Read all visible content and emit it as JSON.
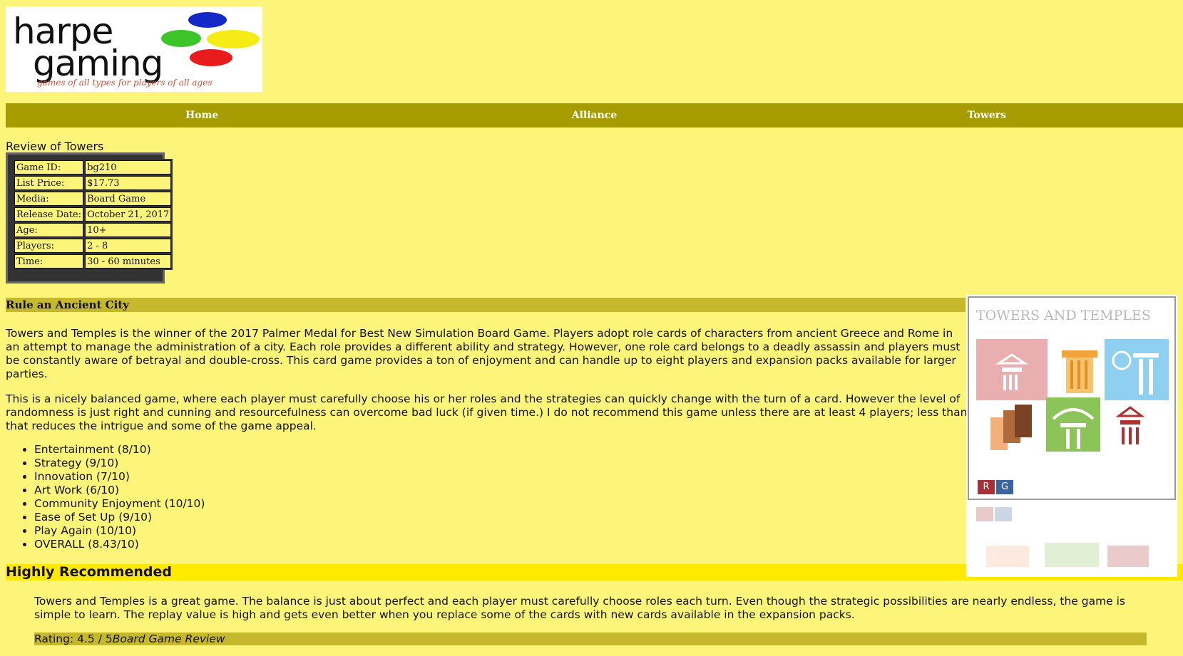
{
  "logo": {
    "line1": "harpe",
    "line2": "gaming",
    "tagline": "games of all types for players of all ages"
  },
  "nav": {
    "items": [
      {
        "label": "Home"
      },
      {
        "label": "Alliance"
      },
      {
        "label": "Towers"
      }
    ]
  },
  "review": {
    "title": "Review of Towers",
    "info": [
      {
        "key": "Game ID:",
        "value": "bg210"
      },
      {
        "key": "List Price:",
        "value": "$17.73"
      },
      {
        "key": "Media:",
        "value": "Board Game"
      },
      {
        "key": "Release Date:",
        "value": "October 21, 2017"
      },
      {
        "key": "Age:",
        "value": "10+"
      },
      {
        "key": "Players:",
        "value": "2 - 8"
      },
      {
        "key": "Time:",
        "value": "30 - 60 minutes"
      }
    ],
    "section_heading": "Rule an Ancient City",
    "paragraph1": "Towers and Temples is the winner of the 2017 Palmer Medal for Best New Simulation Board Game. Players adopt role cards of characters from ancient Greece and Rome in an attempt to manage the administration of a city. Each role provides a different ability and strategy. However, one role card belongs to a deadly assassin and players must be constantly aware of betrayal and double-cross. This card game provides a ton of enjoyment and can handle up to eight players and expansion packs available for larger parties.",
    "paragraph2": "This is a nicely balanced game, where each player must carefully choose his or her roles and the strategies can quickly change with the turn of a card. However the level of randomness is just right and cunning and resourcefulness can overcome bad luck (if given time.) I do not recommend this game unless there are at least 4 players; less than that reduces the intrigue and some of the game appeal.",
    "ratings": [
      "Entertainment (8/10)",
      "Strategy (9/10)",
      "Innovation (7/10)",
      "Art Work (6/10)",
      "Community Enjoyment (10/10)",
      "Ease of Set Up (9/10)",
      "Play Again (10/10)",
      "OVERALL (8.43/10)"
    ],
    "recommendation": "Highly Recommended",
    "conclusion": "Towers and Temples is a great game. The balance is just about perfect and each player must carefully choose roles each turn. Even though the strategic possibilities are nearly endless, the game is simple to learn. The replay value is high and gets even better when you replace some of the cards with new cards available in the expansion packs.",
    "rating_label": "Rating: 4.5 / 5",
    "rating_source": "Board Game Review"
  },
  "cover": {
    "title": "TOWERS AND TEMPLES",
    "badge_r": "R",
    "badge_g": "G"
  },
  "colors": {
    "background": "#fdf47a",
    "nav": "#a69c00",
    "section_bar": "#c6b82c",
    "recommend_bar": "#ffe900"
  }
}
